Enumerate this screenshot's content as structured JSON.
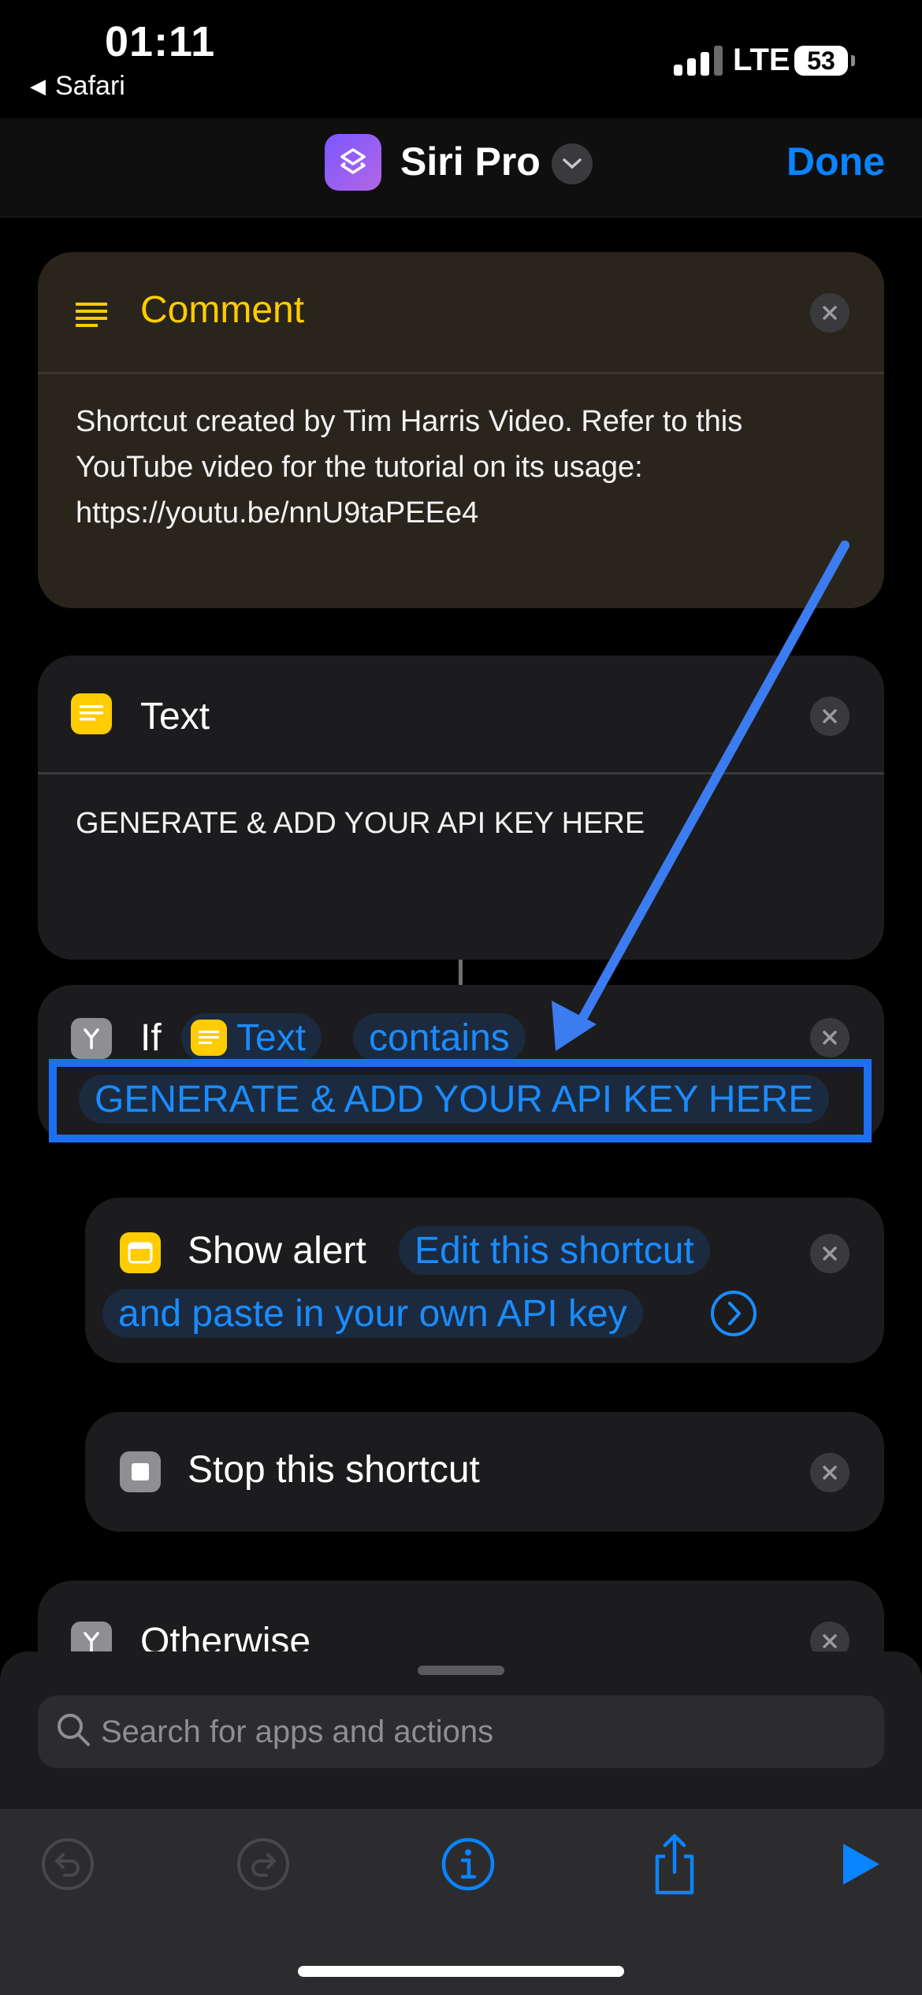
{
  "status_bar": {
    "time": "01:11",
    "back_app": "Safari",
    "network": "LTE",
    "battery": "53"
  },
  "nav": {
    "title": "Siri Pro",
    "done_label": "Done"
  },
  "comment_card": {
    "title": "Comment",
    "text": "Shortcut created by Tim Harris Video. Refer to this YouTube video for the tutorial on its usage: https://youtu.be/nnU9taPEEe4"
  },
  "text_card": {
    "title": "Text",
    "text": "GENERATE & ADD YOUR API KEY HERE"
  },
  "if_card": {
    "keyword": "If",
    "variable": "Text",
    "condition": "contains",
    "value": "GENERATE & ADD YOUR API KEY HERE"
  },
  "alert_card": {
    "title": "Show alert",
    "message_line1": "Edit this shortcut",
    "message_line2": "and paste in your own API key"
  },
  "stop_card": {
    "title": "Stop this shortcut"
  },
  "otherwise_card": {
    "title": "Otherwise"
  },
  "search": {
    "placeholder": "Search for apps and actions"
  },
  "colors": {
    "accent": "#0a84ff",
    "comment_title": "#ffcc00",
    "annotation": "#3b7cf0"
  }
}
